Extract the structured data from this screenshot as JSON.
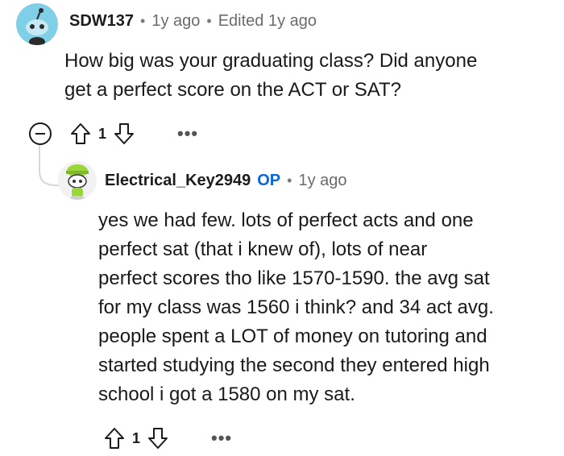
{
  "comment1": {
    "username": "SDW137",
    "separator": "•",
    "time": "1y ago",
    "edited": "Edited 1y ago",
    "text_lines": [
      "How big was your graduating class? Did anyone",
      "get a perfect score on the ACT or SAT?"
    ],
    "votes": "1",
    "more": "•••"
  },
  "comment2": {
    "username": "Electrical_Key2949",
    "op_badge": "OP",
    "separator": "•",
    "time": "1y ago",
    "text_lines": [
      "yes we had few. lots of perfect acts and one",
      "perfect sat (that i knew of), lots of near",
      "perfect scores tho like 1570-1590. the avg sat",
      "for my class was 1560 i think? and 34 act avg.",
      "people spent a LOT of money on tutoring and",
      "started studying the second they entered high",
      "school i got a 1580 on my sat."
    ],
    "votes": "1",
    "more": "•••"
  },
  "colors": {
    "op": "#0a66d8",
    "avatar1_bg": "#7fcfe6",
    "avatar2_accent": "#9ad63a",
    "thread_line": "#d7d7d7"
  },
  "icons": [
    "snoo-avatar",
    "snoo-green-hat-avatar",
    "upvote-icon",
    "downvote-icon",
    "collapse-icon",
    "more-options-icon"
  ]
}
